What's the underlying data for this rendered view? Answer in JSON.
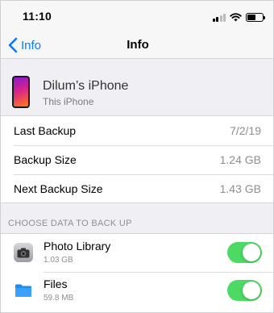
{
  "status_bar": {
    "time": "11:10"
  },
  "nav": {
    "back_label": "Info",
    "title": "Info"
  },
  "device": {
    "name": "Dilum’s iPhone",
    "subtitle": "This iPhone"
  },
  "info_rows": [
    {
      "label": "Last Backup",
      "value": "7/2/19"
    },
    {
      "label": "Backup Size",
      "value": "1.24 GB"
    },
    {
      "label": "Next Backup Size",
      "value": "1.43 GB"
    }
  ],
  "section": {
    "title": "CHOOSE DATA TO BACK UP"
  },
  "apps": [
    {
      "name": "Photo Library",
      "size": "1.03 GB",
      "icon": "camera-icon",
      "enabled": true
    },
    {
      "name": "Files",
      "size": "59.8 MB",
      "icon": "folder-icon",
      "enabled": true
    }
  ],
  "colors": {
    "accent": "#0a7aff",
    "toggle_on": "#4cd964"
  }
}
